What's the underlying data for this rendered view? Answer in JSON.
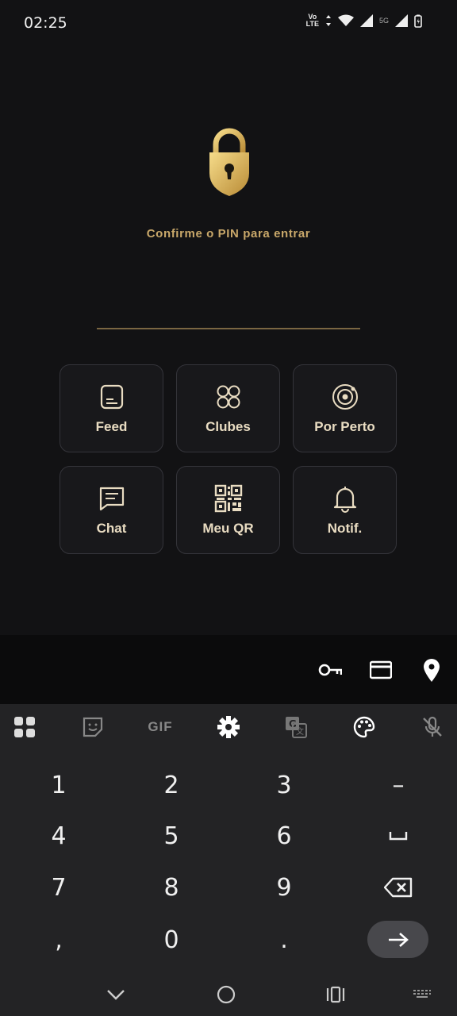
{
  "status_bar": {
    "time": "02:25",
    "volte_line1": "Vo",
    "volte_line2": "LTE",
    "network": "5G",
    "icons": [
      "wifi-icon",
      "signal-icon",
      "battery-icon"
    ]
  },
  "lock_screen": {
    "icon": "padlock-icon",
    "prompt": "Confirme o PIN para entrar",
    "pin_value": ""
  },
  "shortcuts": [
    {
      "label": "Feed",
      "icon": "feed-icon"
    },
    {
      "label": "Clubes",
      "icon": "clubs-icon"
    },
    {
      "label": "Por Perto",
      "icon": "radar-icon"
    },
    {
      "label": "Chat",
      "icon": "chat-icon"
    },
    {
      "label": "Meu QR",
      "icon": "qr-code-icon"
    },
    {
      "label": "Notif.",
      "icon": "bell-icon"
    }
  ],
  "autofill_bar": {
    "icons": [
      "key-icon",
      "credit-card-icon",
      "location-pin-icon"
    ]
  },
  "keyboard_toolbar": {
    "icons": [
      "apps-grid-icon",
      "sticker-icon",
      "gif-icon",
      "settings-icon",
      "translate-icon",
      "palette-icon",
      "mic-off-icon"
    ],
    "gif_label": "GIF"
  },
  "keypad": {
    "rows": [
      [
        "1",
        "2",
        "3",
        "–"
      ],
      [
        "4",
        "5",
        "6",
        "␣"
      ],
      [
        "7",
        "8",
        "9",
        "⌫"
      ],
      [
        ",",
        "0",
        ".",
        "→"
      ]
    ]
  },
  "nav_bar": {
    "icons": [
      "hide-keyboard-icon",
      "home-icon",
      "recents-icon",
      "keyboard-switch-icon"
    ]
  },
  "colors": {
    "gold": "#c9a86a",
    "background": "#121214",
    "tile_bg": "#18181b",
    "keyboard_bg": "#232325"
  }
}
